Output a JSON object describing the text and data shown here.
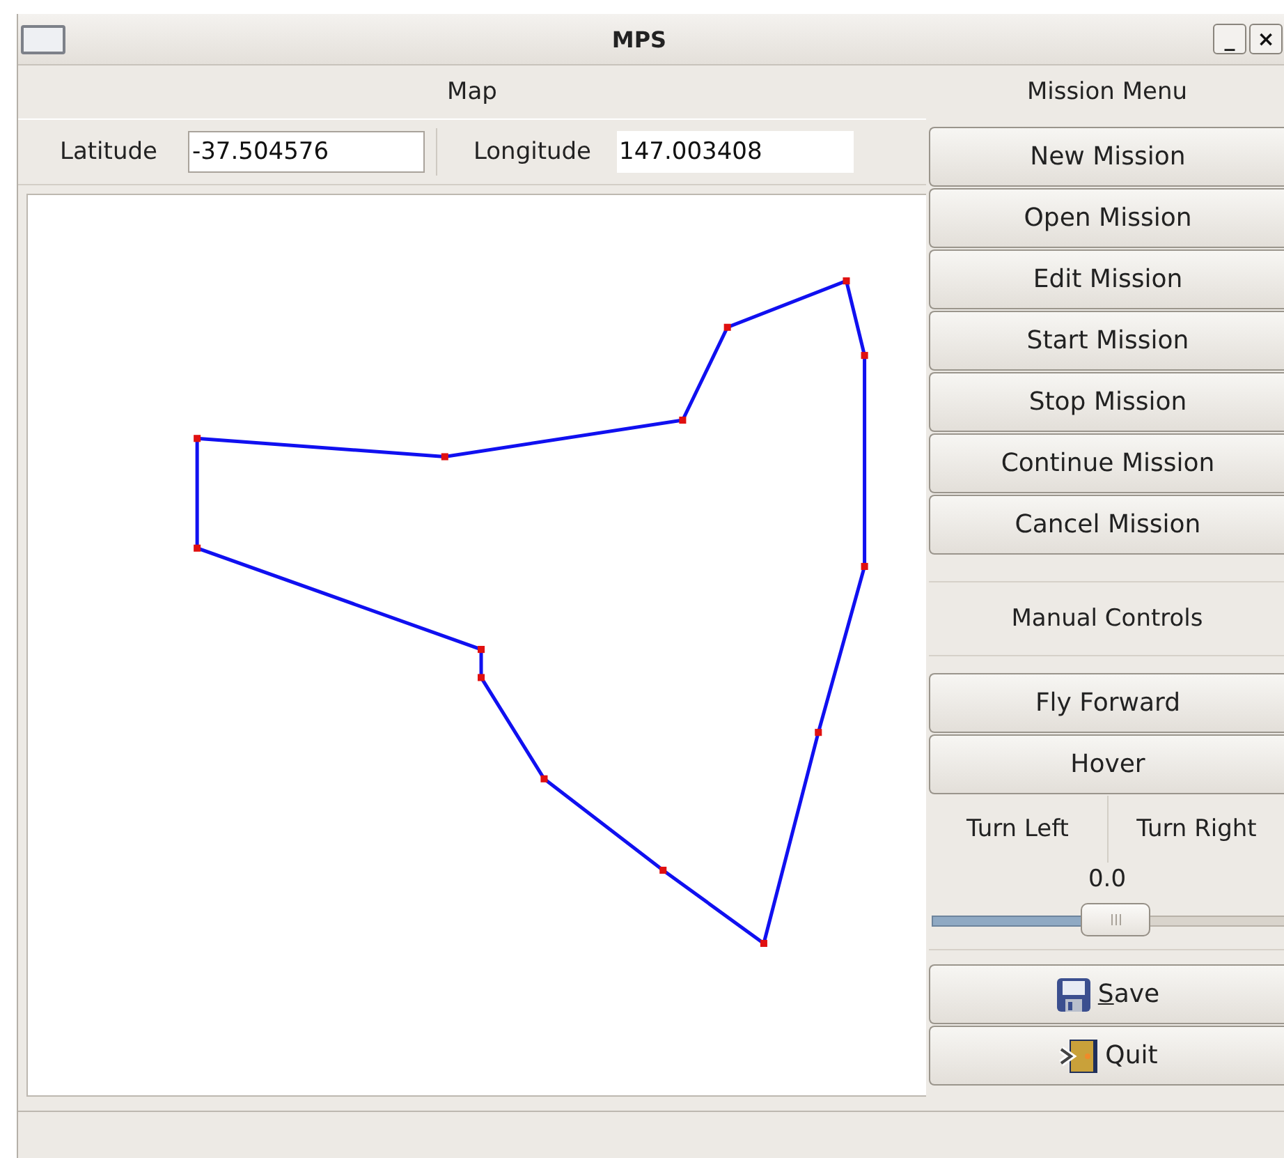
{
  "window": {
    "title": "MPS",
    "controls": [
      "_",
      "×"
    ]
  },
  "map": {
    "heading": "Map",
    "latitude": {
      "label": "Latitude",
      "value": "-37.504576"
    },
    "longitude": {
      "label": "Longitude",
      "value": "147.003408"
    }
  },
  "mission_menu": {
    "heading": "Mission Menu",
    "buttons": [
      "New Mission",
      "Open Mission",
      "Edit Mission",
      "Start Mission",
      "Stop Mission",
      "Continue Mission",
      "Cancel Mission"
    ]
  },
  "manual_controls": {
    "heading": "Manual Controls",
    "buttons": [
      "Fly Forward",
      "Hover"
    ],
    "turn_buttons": [
      "Turn Left",
      "Turn Right"
    ],
    "slider": {
      "reading": "0.0",
      "level": 0.43
    }
  },
  "actions": [
    {
      "kind": "save",
      "label": "Save",
      "mnemonic": true
    },
    {
      "kind": "quit",
      "label": "Quit",
      "mnemonic": false
    }
  ]
}
